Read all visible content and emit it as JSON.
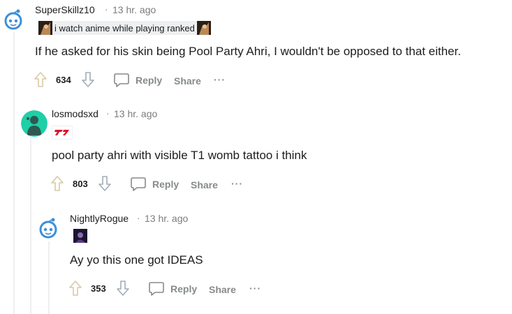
{
  "comments": [
    {
      "username": "SuperSkillz10",
      "separator": "·",
      "time": "13 hr. ago",
      "flair_text": "i watch anime while playing ranked",
      "body": "If he asked for his skin being Pool Party Ahri, I wouldn't be opposed to that either.",
      "score": "634",
      "reply_label": "Reply",
      "share_label": "Share",
      "more_label": "···"
    },
    {
      "username": "losmodsxd",
      "separator": "·",
      "time": "13 hr. ago",
      "flair_text": "",
      "body": "pool party ahri with visible T1 womb tattoo i think",
      "score": "803",
      "reply_label": "Reply",
      "share_label": "Share",
      "more_label": "···"
    },
    {
      "username": "NightlyRogue",
      "separator": "·",
      "time": "13 hr. ago",
      "flair_text": "",
      "body": "Ay yo this one got IDEAS",
      "score": "353",
      "reply_label": "Reply",
      "share_label": "Share",
      "more_label": "···"
    }
  ],
  "colors": {
    "upvote": "#d7c9a4",
    "downvote": "#a2acb6",
    "thread_line": "#edeff1",
    "avatar_blue": "#3c8fd8",
    "avatar_teal": "#1fcfa8",
    "t1_red": "#e2012d"
  }
}
